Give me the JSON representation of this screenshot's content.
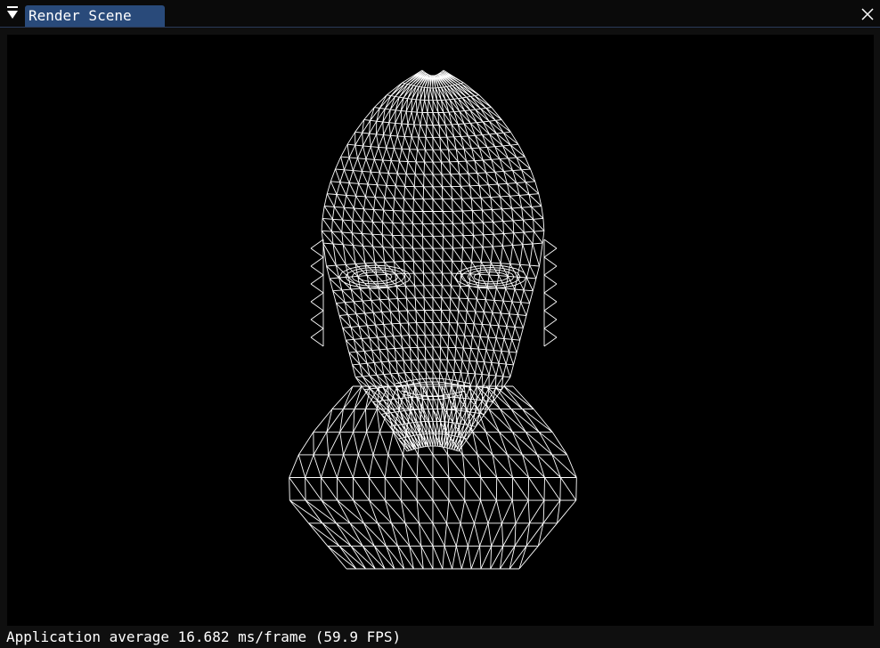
{
  "window": {
    "tab_title": "Render Scene"
  },
  "status": {
    "text": "Application average 16.682 ms/frame (59.9 FPS)"
  },
  "icons": {
    "collapse": "collapse-triangle-icon",
    "close": "close-x-icon"
  },
  "colors": {
    "tab_active": "#294a7a",
    "viewport_bg": "#000000",
    "wireframe": "#ffffff"
  }
}
